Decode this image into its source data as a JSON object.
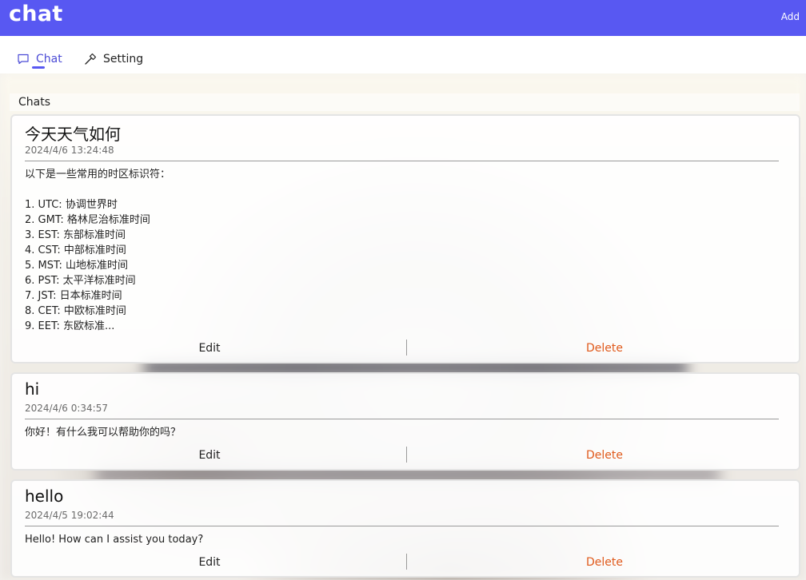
{
  "app": {
    "title": "chat",
    "add_label": "Add",
    "accent_color": "#5858f2",
    "delete_color": "#e05a1c"
  },
  "tabs": [
    {
      "label": "Chat",
      "icon": "chat-bubble-icon",
      "selected": true
    },
    {
      "label": "Setting",
      "icon": "hammer-icon",
      "selected": false
    }
  ],
  "section": {
    "label": "Chats"
  },
  "chats": [
    {
      "title": "今天天气如何",
      "time": "2024/4/6 13:24:48",
      "preview": "以下是一些常用的时区标识符：\n\n1. UTC: 协调世界时\n2. GMT: 格林尼治标准时间\n3. EST: 东部标准时间\n4. CST: 中部标准时间\n5. MST: 山地标准时间\n6. PST: 太平洋标准时间\n7. JST: 日本标准时间\n8. CET: 中欧标准时间\n9. EET: 东欧标准...",
      "edit_label": "Edit",
      "delete_label": "Delete"
    },
    {
      "title": "hi",
      "time": "2024/4/6 0:34:57",
      "preview": "你好！有什么我可以帮助你的吗？",
      "edit_label": "Edit",
      "delete_label": "Delete"
    },
    {
      "title": "hello",
      "time": "2024/4/5 19:02:44",
      "preview": "Hello! How can I assist you today?",
      "edit_label": "Edit",
      "delete_label": "Delete"
    }
  ]
}
